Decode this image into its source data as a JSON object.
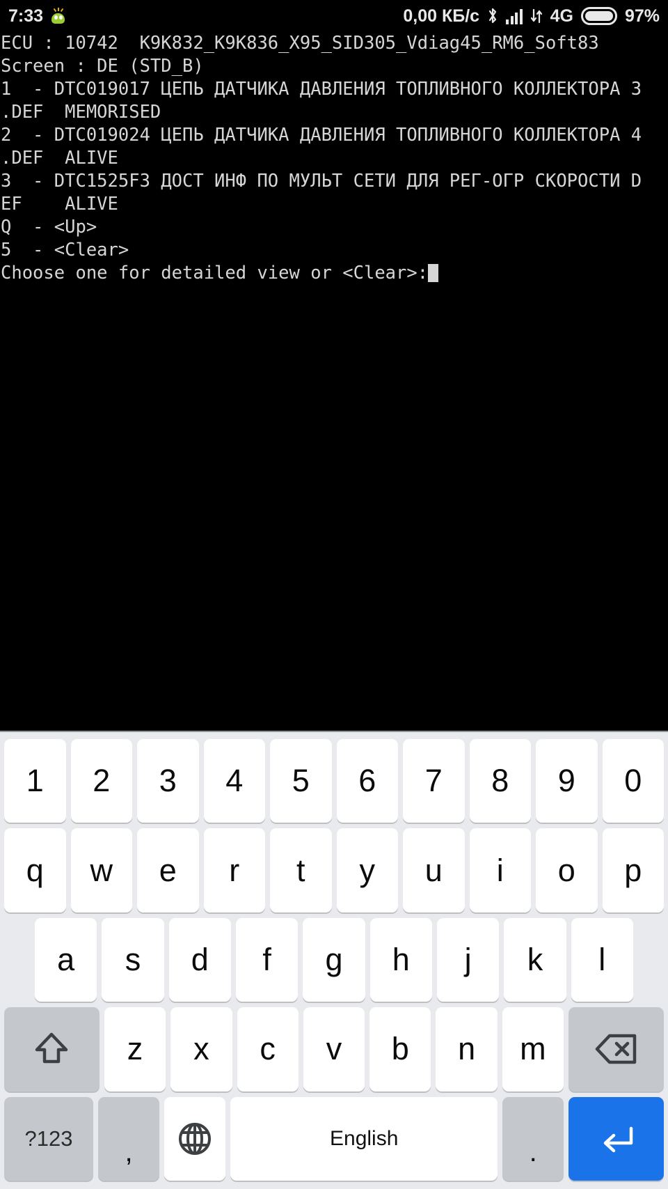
{
  "status_bar": {
    "time": "7:33",
    "notification_icon": "app-notification-icon",
    "data_speed": "0,00 КБ/c",
    "bluetooth_icon": "bluetooth-icon",
    "signal_icon": "cellular-signal-icon",
    "data_transfer_icon": "data-transfer-arrows-icon",
    "network_type": "4G",
    "battery_icon": "battery-icon",
    "battery_percent": "97%"
  },
  "terminal": {
    "lines": [
      "ECU : 10742  K9K832_K9K836_X95_SID305_Vdiag45_RM6_Soft83",
      "Screen : DE (STD_B)",
      "1  - DTC019017 ЦЕПЬ ДАТЧИКА ДАВЛЕНИЯ ТОПЛИВНОГО КОЛЛЕКТОРА 3",
      ".DEF  MEMORISED",
      "2  - DTC019024 ЦЕПЬ ДАТЧИКА ДАВЛЕНИЯ ТОПЛИВНОГО КОЛЛЕКТОРА 4",
      ".DEF  ALIVE",
      "3  - DTC1525F3 ДОСТ ИНФ ПО МУЛЬТ СЕТИ ДЛЯ РЕГ-ОГР СКОРОСТИ D",
      "EF    ALIVE",
      "Q  - <Up>",
      "5  - <Clear>"
    ],
    "prompt": "Choose one for detailed view or <Clear>:"
  },
  "keyboard": {
    "language_label": "English",
    "rows": {
      "digits": [
        "1",
        "2",
        "3",
        "4",
        "5",
        "6",
        "7",
        "8",
        "9",
        "0"
      ],
      "qwerty": [
        "q",
        "w",
        "e",
        "r",
        "t",
        "y",
        "u",
        "i",
        "o",
        "p"
      ],
      "asdf": [
        "a",
        "s",
        "d",
        "f",
        "g",
        "h",
        "j",
        "k",
        "l"
      ],
      "zxcv": [
        "z",
        "x",
        "c",
        "v",
        "b",
        "n",
        "m"
      ]
    },
    "shift_icon": "shift-arrow-icon",
    "backspace_icon": "backspace-icon",
    "symbols_label": "?123",
    "comma_label": ",",
    "globe_icon": "globe-language-icon",
    "period_label": ".",
    "enter_icon": "enter-return-icon"
  },
  "colors": {
    "terminal_bg": "#000000",
    "terminal_text": "#d6d6d6",
    "keyboard_bg": "#e8eaed",
    "key_bg": "#ffffff",
    "key_fn_bg": "#c4c8cd",
    "enter_accent": "#1a73e8"
  }
}
